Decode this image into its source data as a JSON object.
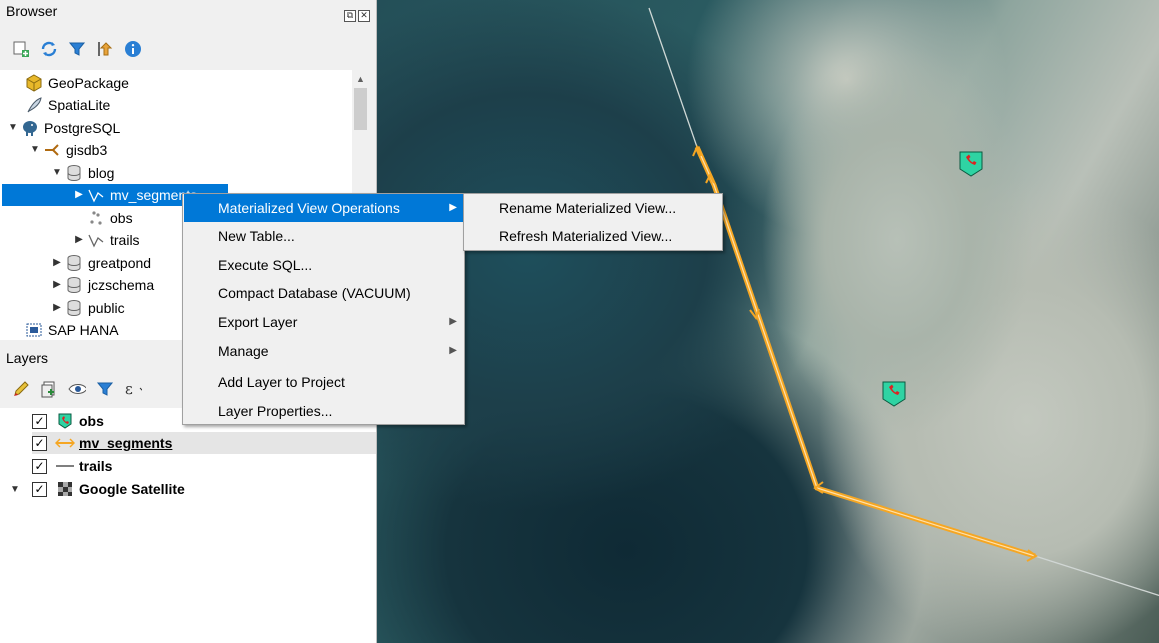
{
  "browser": {
    "title": "Browser",
    "items": [
      {
        "label": "GeoPackage"
      },
      {
        "label": "SpatiaLite"
      },
      {
        "label": "PostgreSQL"
      },
      {
        "label": "gisdb3"
      },
      {
        "label": "blog"
      },
      {
        "label": "mv_segments"
      },
      {
        "label": "obs"
      },
      {
        "label": "trails"
      },
      {
        "label": "greatpond"
      },
      {
        "label": "jczschema"
      },
      {
        "label": "public"
      },
      {
        "label": "SAP HANA"
      }
    ]
  },
  "layers": {
    "title": "Layers",
    "items": [
      {
        "label": "obs"
      },
      {
        "label": "mv_segments"
      },
      {
        "label": "trails"
      },
      {
        "label": "Google Satellite"
      }
    ]
  },
  "context_menu": {
    "items": [
      {
        "label": "Materialized View Operations"
      },
      {
        "label": "New Table..."
      },
      {
        "label": "Execute SQL..."
      },
      {
        "label": "Compact Database (VACUUM)"
      },
      {
        "label": "Export Layer"
      },
      {
        "label": "Manage"
      },
      {
        "label": "Add Layer to Project"
      },
      {
        "label": "Layer Properties..."
      }
    ]
  },
  "submenu": {
    "items": [
      {
        "label": "Rename Materialized View..."
      },
      {
        "label": "Refresh Materialized View..."
      }
    ]
  },
  "colors": {
    "selection": "#0078d7",
    "segment_line": "#f5a623",
    "marker": "#2fd3a3"
  }
}
